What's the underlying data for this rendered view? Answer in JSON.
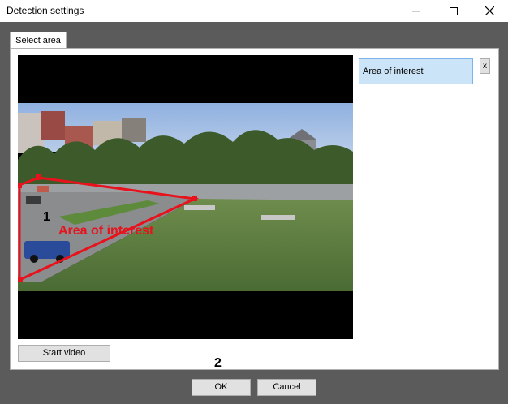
{
  "window": {
    "title": "Detection settings"
  },
  "tabs": [
    {
      "label": "Select area"
    }
  ],
  "video": {
    "zone_overlay_label": "Area of interest",
    "zone_color": "#e8121c"
  },
  "zones": {
    "items": [
      {
        "label": "Area of interest",
        "delete_label": "x"
      }
    ]
  },
  "buttons": {
    "start_video": "Start video",
    "ok": "OK",
    "cancel": "Cancel"
  },
  "callouts": {
    "one": "1",
    "two": "2"
  },
  "colors": {
    "selected_item_bg": "#cce4f7",
    "selected_item_border": "#7eb4ea"
  }
}
